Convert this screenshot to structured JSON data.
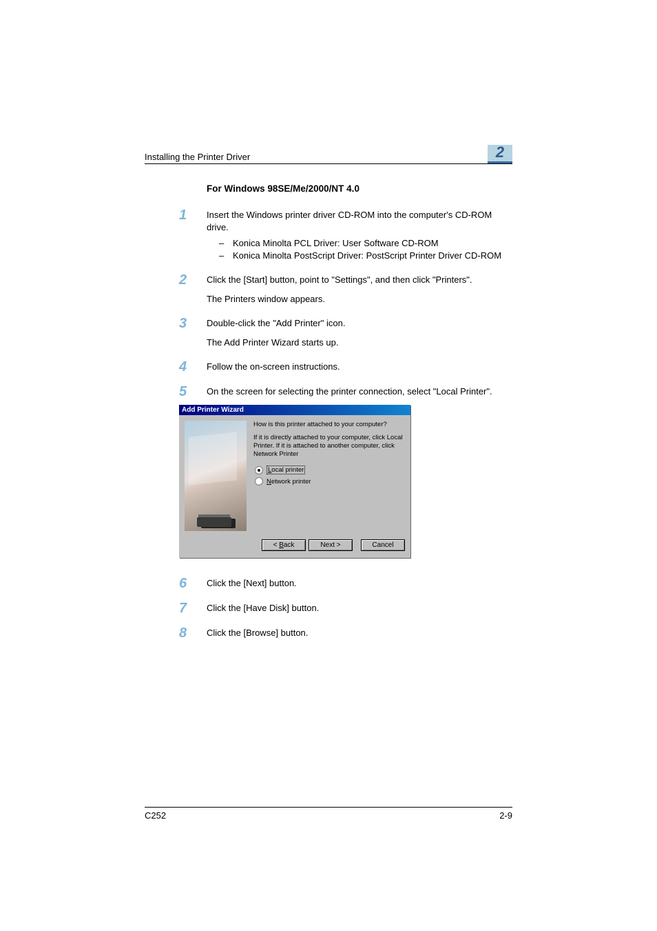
{
  "header": {
    "running_title": "Installing the Printer Driver",
    "chapter_number": "2"
  },
  "section": {
    "heading": "For Windows 98SE/Me/2000/NT 4.0"
  },
  "steps": {
    "s1": {
      "num": "1",
      "text": "Insert the Windows printer driver CD-ROM into the computer's CD-ROM drive.",
      "sub1": "Konica Minolta PCL Driver: User Software CD-ROM",
      "sub2": "Konica Minolta PostScript Driver: PostScript Printer Driver CD-ROM"
    },
    "s2": {
      "num": "2",
      "text": "Click the [Start] button, point to \"Settings\", and then click \"Printers\".",
      "text2": "The Printers window appears."
    },
    "s3": {
      "num": "3",
      "text": "Double-click the \"Add Printer\" icon.",
      "text2": "The Add Printer Wizard starts up."
    },
    "s4": {
      "num": "4",
      "text": "Follow the on-screen instructions."
    },
    "s5": {
      "num": "5",
      "text": "On the screen for selecting the printer connection, select \"Local Printer\"."
    },
    "s6": {
      "num": "6",
      "text": "Click the [Next] button."
    },
    "s7": {
      "num": "7",
      "text": "Click the [Have Disk] button."
    },
    "s8": {
      "num": "8",
      "text": "Click the [Browse] button."
    }
  },
  "wizard": {
    "title": "Add Printer Wizard",
    "question": "How is this printer attached to your computer?",
    "instruction": "If it is directly attached to your computer, click Local Printer. If it is attached to another computer, click Network Printer",
    "opt_local_u": "L",
    "opt_local_rest": "ocal printer",
    "opt_net_u": "N",
    "opt_net_rest": "etwork printer",
    "btn_back_lead": "< ",
    "btn_back_u": "B",
    "btn_back_rest": "ack",
    "btn_next": "Next >",
    "btn_cancel": "Cancel"
  },
  "footer": {
    "model": "C252",
    "page": "2-9"
  }
}
